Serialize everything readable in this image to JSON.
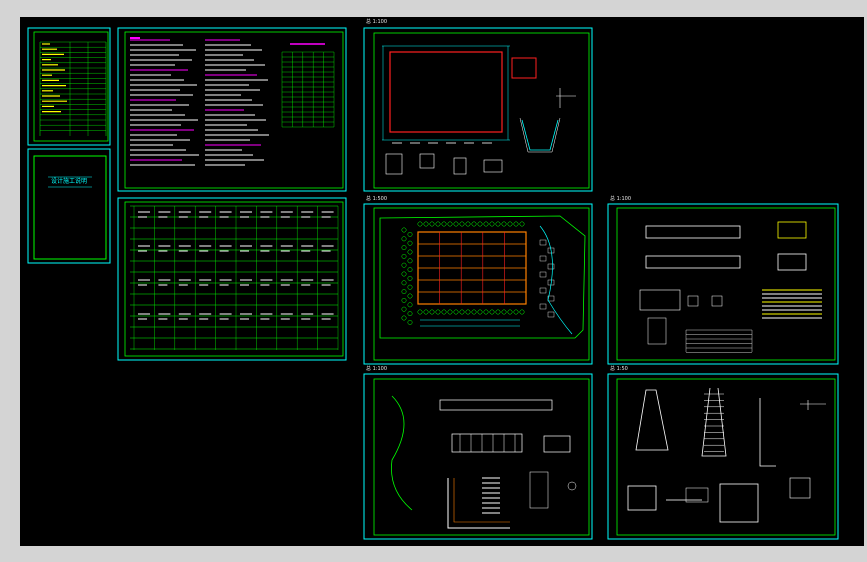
{
  "sheet_labels": {
    "plan": "总 1:100",
    "site": "总 1:500",
    "building": "总 1:100",
    "details_left": "总 1:100",
    "details_right": "总 1:50"
  },
  "cover_title": "设计施工说明",
  "colors": {
    "background": "#000000",
    "frame": "#00ffff",
    "inner_frame": "#00ff00",
    "text": "#ffffff",
    "accent_magenta": "#ff00ff",
    "accent_red": "#ff2020",
    "accent_orange": "#ff8000",
    "accent_yellow": "#ffff00",
    "chrome": "#d4d4d4"
  }
}
